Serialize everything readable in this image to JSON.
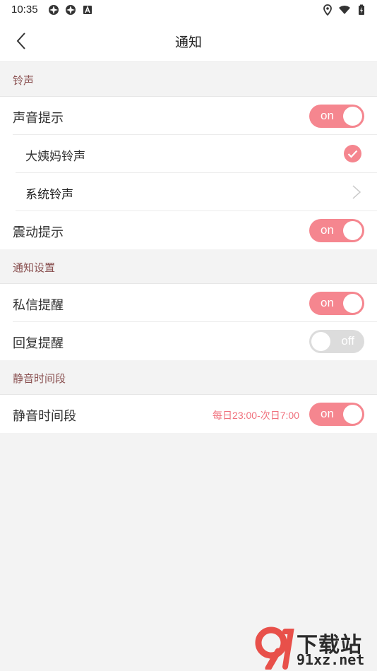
{
  "status_bar": {
    "time": "10:35",
    "left_icons": [
      "app-icon",
      "app-icon",
      "notification-icon"
    ],
    "right_icons": [
      "location-icon",
      "wifi-icon",
      "battery-icon"
    ]
  },
  "header": {
    "title": "通知"
  },
  "sections": [
    {
      "title": "铃声",
      "rows": [
        {
          "label": "声音提示",
          "control": "toggle",
          "state": "on",
          "toggle_text": "on"
        },
        {
          "label": "大姨妈铃声",
          "control": "check",
          "checked": true
        },
        {
          "label": "系统铃声",
          "control": "chevron"
        },
        {
          "label": "震动提示",
          "control": "toggle",
          "state": "on",
          "toggle_text": "on"
        }
      ]
    },
    {
      "title": "通知设置",
      "rows": [
        {
          "label": "私信提醒",
          "control": "toggle",
          "state": "on",
          "toggle_text": "on"
        },
        {
          "label": "回复提醒",
          "control": "toggle",
          "state": "off",
          "toggle_text": "off"
        }
      ]
    },
    {
      "title": "静音时间段",
      "rows": [
        {
          "label": "静音时间段",
          "value": "每日23:00-次日7:00",
          "control": "toggle",
          "state": "on",
          "toggle_text": "on"
        }
      ]
    }
  ],
  "watermark": {
    "title": "下载站",
    "domain": "91xz.net"
  },
  "colors": {
    "accent": "#f5868f",
    "section_text": "#8a5050",
    "background": "#f3f3f3",
    "toggle_off": "#dcdcdc"
  }
}
